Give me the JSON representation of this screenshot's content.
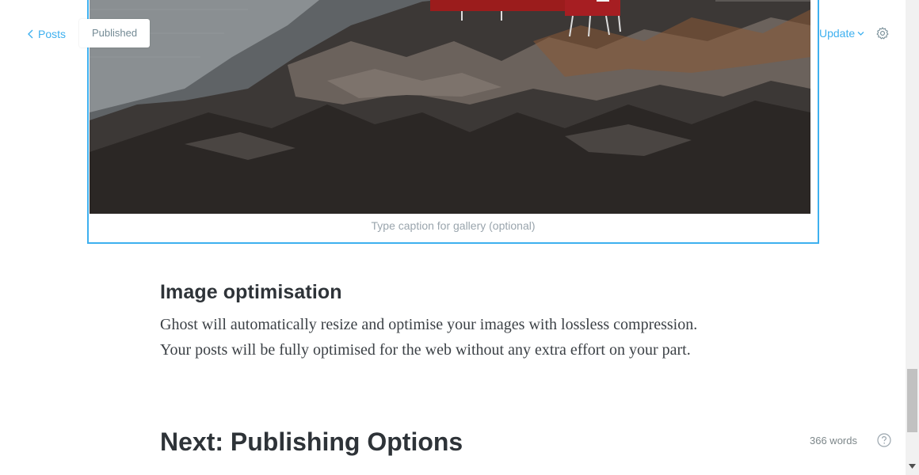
{
  "topbar": {
    "back_label": "Posts",
    "status": "Published",
    "update_label": "Update"
  },
  "gallery": {
    "caption_placeholder": "Type caption for gallery (optional)"
  },
  "editor": {
    "section_heading": "Image optimisation",
    "section_paragraph": "Ghost will automatically resize and optimise your images with lossless compression. Your posts will be fully optimised for the web without any extra effort on your part.",
    "next_heading": "Next: Publishing Options"
  },
  "footer": {
    "word_count": "366 words"
  },
  "colors": {
    "accent": "#3eb0ef",
    "muted": "#738a94"
  }
}
